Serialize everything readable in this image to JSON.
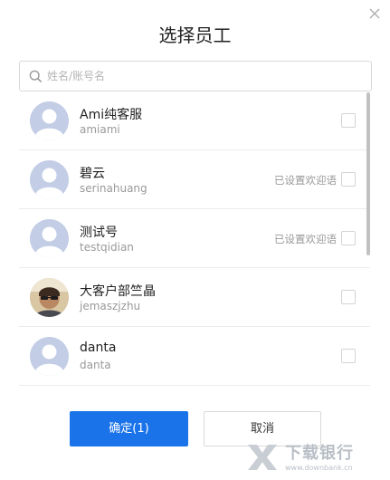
{
  "dialog": {
    "title": "选择员工",
    "close_icon": "close-icon"
  },
  "search": {
    "placeholder": "姓名/账号名",
    "value": "",
    "icon": "search-icon"
  },
  "employees": [
    {
      "name": "Ami纯客服",
      "account": "amiami",
      "status": "",
      "checked": false,
      "avatar": "default-avatar-icon"
    },
    {
      "name": "碧云",
      "account": "serinahuang",
      "status": "已设置欢迎语",
      "checked": false,
      "avatar": "default-avatar-icon"
    },
    {
      "name": "测试号",
      "account": "testqidian",
      "status": "已设置欢迎语",
      "checked": false,
      "avatar": "default-avatar-icon"
    },
    {
      "name": "大客户部竺晶",
      "account": "jemaszjzhu",
      "status": "",
      "checked": false,
      "avatar": "photo-avatar"
    },
    {
      "name": "danta",
      "account": "danta",
      "status": "",
      "checked": false,
      "avatar": "default-avatar-icon"
    }
  ],
  "footer": {
    "confirm_label": "确定(1)",
    "cancel_label": "取消"
  },
  "watermark": {
    "text": "下载银行",
    "url": "www.downbank.cn"
  },
  "colors": {
    "primary": "#1a73e8",
    "avatar_bg": "#c3cde6",
    "muted_text": "#999999"
  }
}
